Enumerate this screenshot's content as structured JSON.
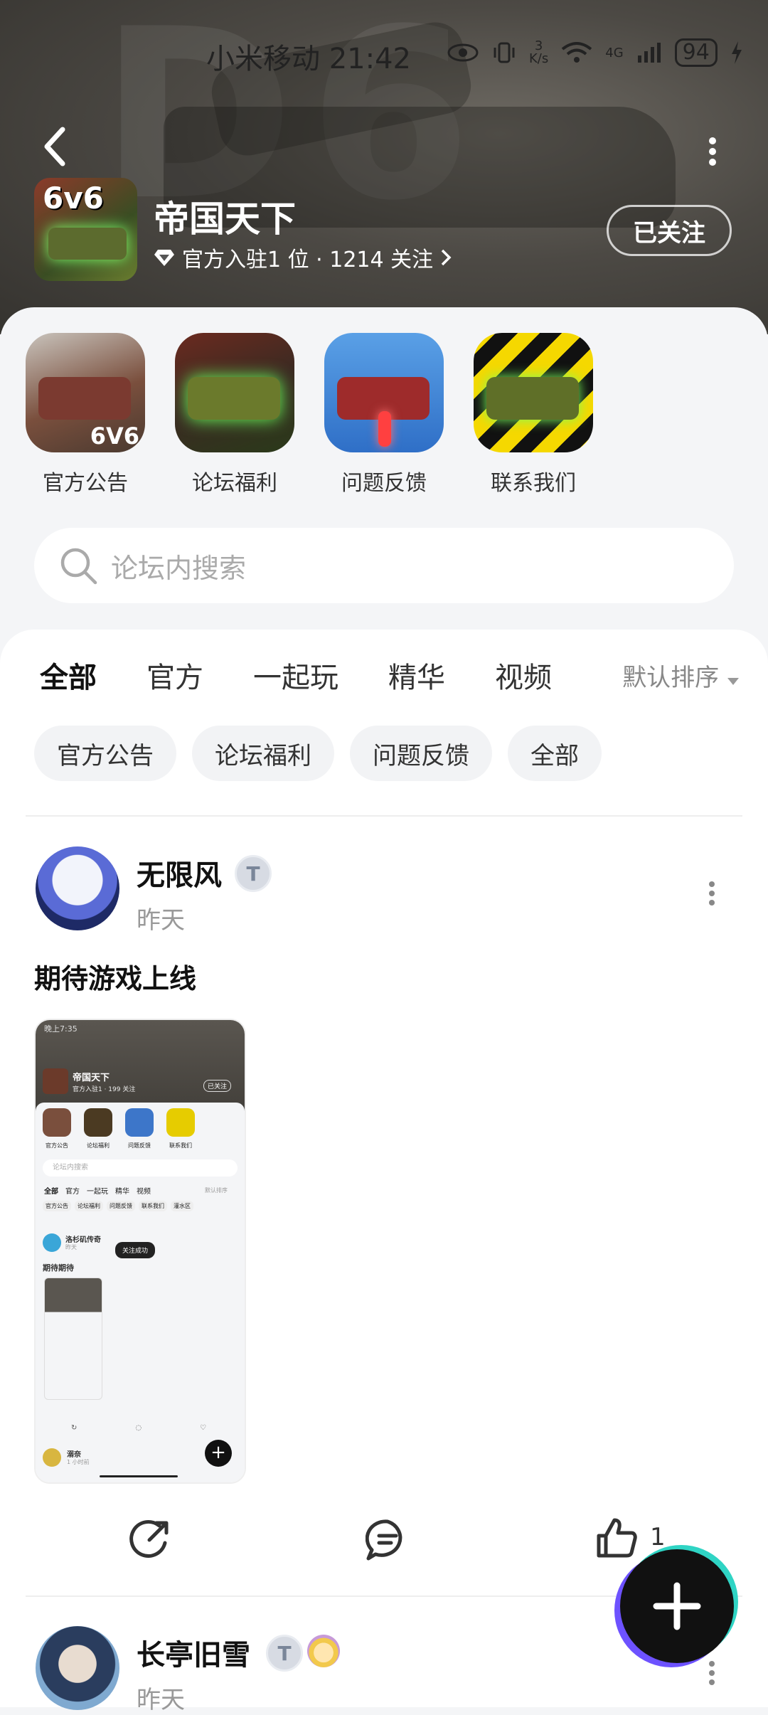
{
  "status_bar": {
    "carrier_time": "小米移动 21:42",
    "net_speed_top": "3",
    "net_speed_unit": "K/s",
    "network": "4G",
    "battery": "94"
  },
  "forum": {
    "title": "帝国天下",
    "meta": "官方入驻1 位 · 1214 关注",
    "follow_label": "已关注",
    "logo_text": "6v6"
  },
  "shortcuts": [
    {
      "label": "官方公告",
      "icon": "tank-6v6-icon"
    },
    {
      "label": "论坛福利",
      "icon": "green-tank-icon"
    },
    {
      "label": "问题反馈",
      "icon": "red-tank-icon"
    },
    {
      "label": "联系我们",
      "icon": "hazard-tank-icon"
    }
  ],
  "shortcut_logo_text": "6V6",
  "search": {
    "placeholder": "论坛内搜索"
  },
  "tabs": [
    "全部",
    "官方",
    "一起玩",
    "精华",
    "视频"
  ],
  "sort_label": "默认排序",
  "chips": [
    "官方公告",
    "论坛福利",
    "问题反馈",
    "全部"
  ],
  "posts": [
    {
      "author": "无限风",
      "badge": "T",
      "time": "昨天",
      "text": "期待游戏上线",
      "likes": "1"
    },
    {
      "author": "长亭旧雪",
      "badge": "T",
      "time": "昨天"
    }
  ],
  "screenshot_preview": {
    "time": "晚上7:35",
    "title": "帝国天下",
    "meta": "官方入驻1 · 199 关注",
    "follow": "已关注",
    "shortcuts": [
      "官方公告",
      "论坛福利",
      "问题反馈",
      "联系我们"
    ],
    "search": "论坛内搜索",
    "tabs": [
      "全部",
      "官方",
      "一起玩",
      "精华",
      "视频"
    ],
    "sort": "默认排序",
    "chips": [
      "官方公告",
      "论坛福利",
      "问题反馈",
      "联系我们",
      "灌水区"
    ],
    "post_author": "洛杉矶传奇",
    "post_time": "昨天",
    "toast": "关注成功",
    "post_text": "期待期待",
    "second_author": "溺奈",
    "second_time": "1 小时前"
  },
  "colors": {
    "accent": "#1fc7b6",
    "fab": "#111111"
  }
}
